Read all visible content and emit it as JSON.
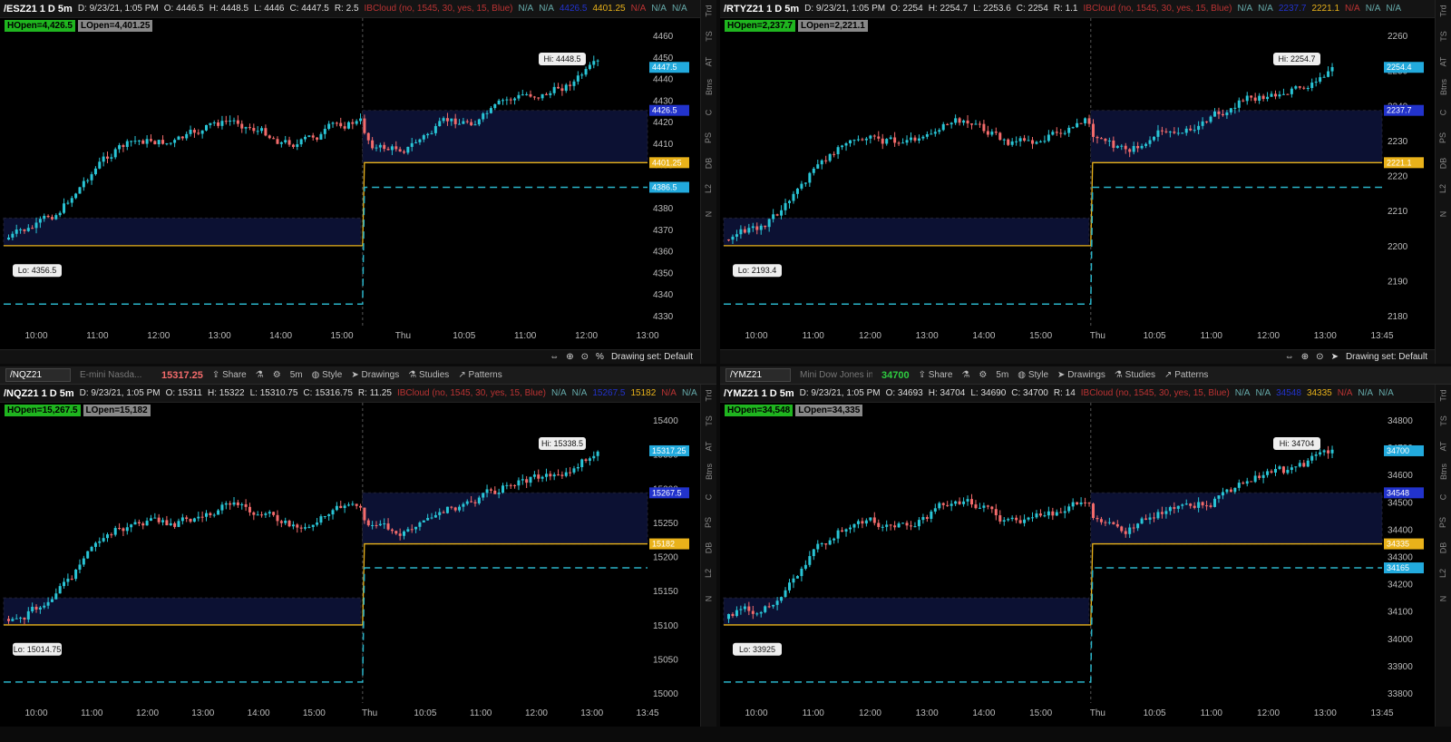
{
  "panels": [
    {
      "id": "es",
      "topbar": {
        "symbol": "/ESZ21 1 D 5m",
        "date": "D: 9/23/21, 1:05 PM",
        "o": "O: 4446.5",
        "h": "H: 4448.5",
        "l": "L: 4446",
        "c": "C: 4447.5",
        "r": "R: 2.5",
        "cloud": "IBCloud (no, 1545, 30, yes, 15, Blue)",
        "vals": [
          "N/A",
          "N/A",
          "4426.5",
          "4401.25",
          "N/A",
          "N/A",
          "N/A"
        ]
      },
      "hopen": "HOpen=4,426.5",
      "lopen": "LOpen=4,401.25",
      "hi_label": "Hi: 4448.5",
      "lo_label": "Lo: 4356.5",
      "price_axis": [
        "4460",
        "4450",
        "4440",
        "4430",
        "4420",
        "4410",
        "4400",
        "4390",
        "4380",
        "4370",
        "4360",
        "4350",
        "4340",
        "4330"
      ],
      "time_axis": [
        "10:00",
        "11:00",
        "12:00",
        "13:00",
        "14:00",
        "15:00",
        "Thu",
        "10:05",
        "11:00",
        "12:00",
        "13:00"
      ],
      "markers": [
        {
          "text": "4447.5",
          "color": "#2ad"
        },
        {
          "text": "4426.5",
          "color": "#23c"
        },
        {
          "text": "4401.25",
          "color": "#e9b21a"
        },
        {
          "text": "4386.5",
          "color": "#2ad"
        }
      ],
      "drawing_set": "Drawing set: Default"
    },
    {
      "id": "rty",
      "topbar": {
        "symbol": "/RTYZ21 1 D 5m",
        "date": "D: 9/23/21, 1:05 PM",
        "o": "O: 2254",
        "h": "H: 2254.7",
        "l": "L: 2253.6",
        "c": "C: 2254",
        "r": "R: 1.1",
        "cloud": "IBCloud (no, 1545, 30, yes, 15, Blue)",
        "vals": [
          "N/A",
          "N/A",
          "2237.7",
          "2221.1",
          "N/A",
          "N/A",
          "N/A"
        ]
      },
      "hopen": "HOpen=2,237.7",
      "lopen": "LOpen=2,221.1",
      "hi_label": "Hi: 2254.7",
      "lo_label": "Lo: 2193.4",
      "price_axis": [
        "2260",
        "2250",
        "2240",
        "2230",
        "2220",
        "2210",
        "2200",
        "2190",
        "2180"
      ],
      "time_axis": [
        "10:00",
        "11:00",
        "12:00",
        "13:00",
        "14:00",
        "15:00",
        "Thu",
        "10:05",
        "11:00",
        "12:00",
        "13:00",
        "13:45"
      ],
      "markers": [
        {
          "text": "2254.4",
          "color": "#2ad"
        },
        {
          "text": "2237.7",
          "color": "#23c"
        },
        {
          "text": "2221.1",
          "color": "#e9b21a"
        }
      ],
      "drawing_set": "Drawing set: Default"
    },
    {
      "id": "nq",
      "toolbar": {
        "symbol": "/NQZ21",
        "desc": "E-mini Nasda...",
        "last": "15317.25",
        "share": "Share",
        "period": "5m",
        "style": "Style",
        "drawings": "Drawings",
        "studies": "Studies",
        "patterns": "Patterns"
      },
      "topbar": {
        "symbol": "/NQZ21 1 D 5m",
        "date": "D: 9/23/21, 1:05 PM",
        "o": "O: 15311",
        "h": "H: 15322",
        "l": "L: 15310.75",
        "c": "C: 15316.75",
        "r": "R: 11.25",
        "cloud": "IBCloud (no, 1545, 30, yes, 15, Blue)",
        "vals": [
          "N/A",
          "N/A",
          "15267.5",
          "15182",
          "N/A",
          "N/A"
        ]
      },
      "hopen": "HOpen=15,267.5",
      "lopen": "LOpen=15,182",
      "hi_label": "Hi: 15338.5",
      "lo_label": "Lo: 15014.75",
      "price_axis": [
        "15400",
        "15350",
        "15300",
        "15250",
        "15200",
        "15150",
        "15100",
        "15050",
        "15000"
      ],
      "time_axis": [
        "10:00",
        "11:00",
        "12:00",
        "13:00",
        "14:00",
        "15:00",
        "Thu",
        "10:05",
        "11:00",
        "12:00",
        "13:00",
        "13:45"
      ],
      "markers": [
        {
          "text": "15317.25",
          "color": "#2ad"
        },
        {
          "text": "15267.5",
          "color": "#23c"
        },
        {
          "text": "15182",
          "color": "#e9b21a"
        }
      ]
    },
    {
      "id": "ym",
      "toolbar": {
        "symbol": "/YMZ21",
        "desc": "Mini Dow Jones in...",
        "last": "34700",
        "share": "Share",
        "period": "5m",
        "style": "Style",
        "drawings": "Drawings",
        "studies": "Studies",
        "patterns": "Patterns"
      },
      "topbar": {
        "symbol": "/YMZ21 1 D 5m",
        "date": "D: 9/23/21, 1:05 PM",
        "o": "O: 34693",
        "h": "H: 34704",
        "l": "L: 34690",
        "c": "C: 34700",
        "r": "R: 14",
        "cloud": "IBCloud (no, 1545, 30, yes, 15, Blue)",
        "vals": [
          "N/A",
          "N/A",
          "34548",
          "34335",
          "N/A",
          "N/A",
          "N/A"
        ]
      },
      "hopen": "HOpen=34,548",
      "lopen": "LOpen=34,335",
      "hi_label": "Hi: 34704",
      "lo_label": "Lo: 33925",
      "price_axis": [
        "34800",
        "34700",
        "34600",
        "34500",
        "34400",
        "34300",
        "34200",
        "34100",
        "34000",
        "33900",
        "33800"
      ],
      "time_axis": [
        "10:00",
        "11:00",
        "12:00",
        "13:00",
        "14:00",
        "15:00",
        "Thu",
        "10:05",
        "11:00",
        "12:00",
        "13:00",
        "13:45"
      ],
      "markers": [
        {
          "text": "34700",
          "color": "#2ad"
        },
        {
          "text": "34548",
          "color": "#23c"
        },
        {
          "text": "34335",
          "color": "#e9b21a"
        },
        {
          "text": "34165",
          "color": "#2ad"
        }
      ]
    }
  ],
  "side_tabs": [
    "Trd",
    "TS",
    "AT",
    "Btns",
    "C",
    "PS",
    "DB",
    "L2",
    "N"
  ],
  "colors": {
    "up": "#29c5d6",
    "down": "#f36b6b",
    "hopen_line": "#e9b21a",
    "dashed": "#2ab3c8",
    "cloud": "#0c1133"
  }
}
